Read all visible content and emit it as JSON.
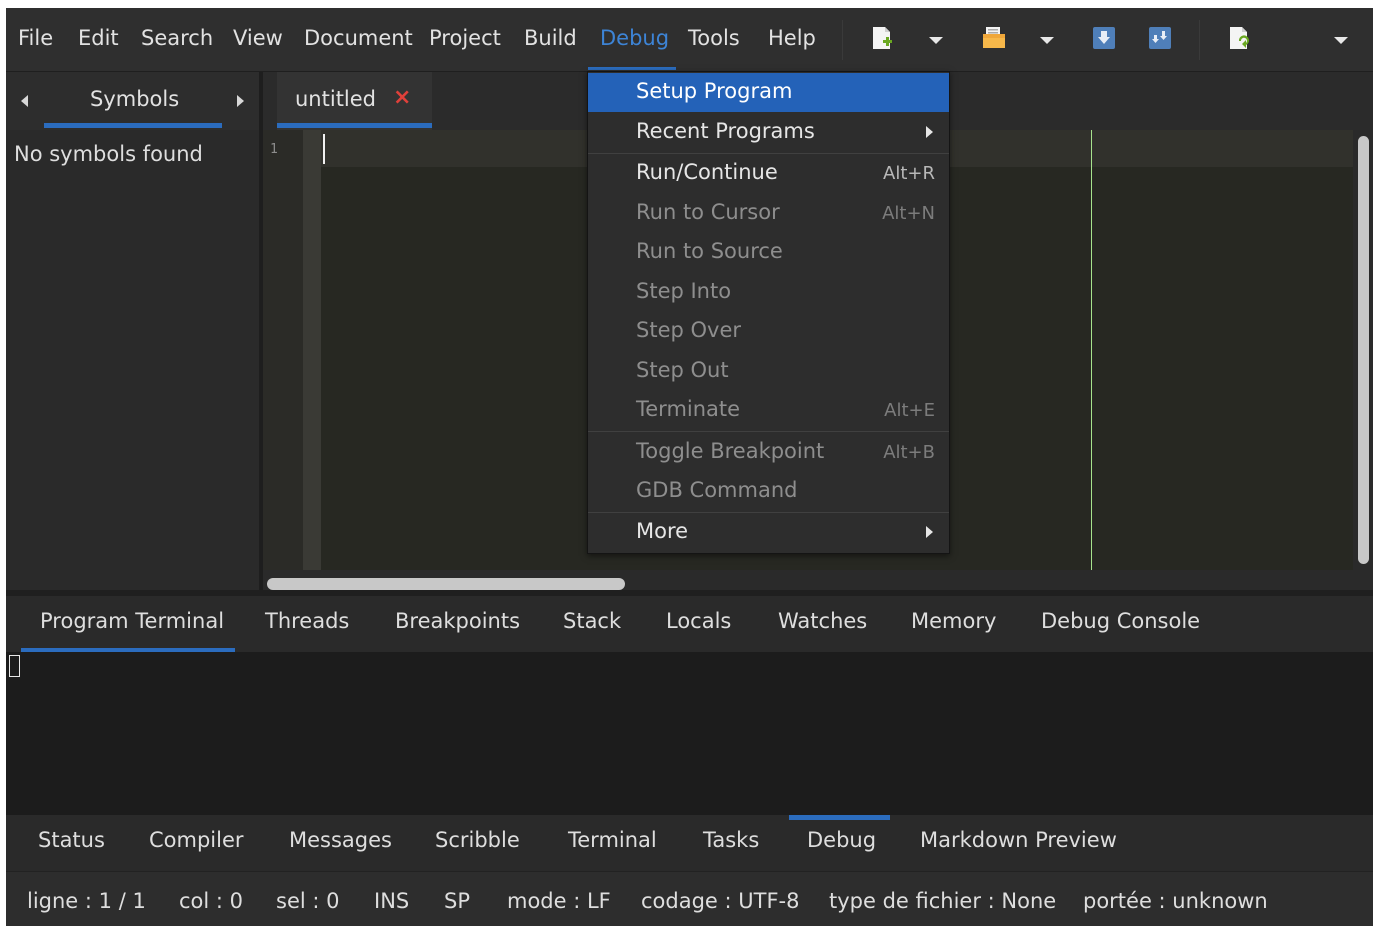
{
  "menubar": {
    "items": [
      "File",
      "Edit",
      "Search",
      "View",
      "Document",
      "Project",
      "Build",
      "Debug",
      "Tools",
      "Help"
    ],
    "active": "Debug"
  },
  "toolbar": {
    "icons": [
      "new-file-icon",
      "dropdown-arrow-icon",
      "open-file-icon",
      "dropdown-arrow-icon",
      "save-icon",
      "save-all-icon",
      "revert-icon",
      "overflow-arrow-icon"
    ]
  },
  "sidebar": {
    "tab_label": "Symbols",
    "empty_text": "No symbols found"
  },
  "editor": {
    "tab_label": "untitled",
    "tab_close": "×",
    "line_number": "1"
  },
  "debug_menu": {
    "items": [
      {
        "label": "Setup Program",
        "shortcut": "",
        "enabled": true,
        "highlighted": true,
        "submenu": false
      },
      {
        "label": "Recent Programs",
        "shortcut": "",
        "enabled": true,
        "highlighted": false,
        "submenu": true
      },
      {
        "label": "Run/Continue",
        "shortcut": "Alt+R",
        "enabled": true,
        "highlighted": false,
        "submenu": false
      },
      {
        "label": "Run to Cursor",
        "shortcut": "Alt+N",
        "enabled": false,
        "highlighted": false,
        "submenu": false
      },
      {
        "label": "Run to Source",
        "shortcut": "",
        "enabled": false,
        "highlighted": false,
        "submenu": false
      },
      {
        "label": "Step Into",
        "shortcut": "",
        "enabled": false,
        "highlighted": false,
        "submenu": false
      },
      {
        "label": "Step Over",
        "shortcut": "",
        "enabled": false,
        "highlighted": false,
        "submenu": false
      },
      {
        "label": "Step Out",
        "shortcut": "",
        "enabled": false,
        "highlighted": false,
        "submenu": false
      },
      {
        "label": "Terminate",
        "shortcut": "Alt+E",
        "enabled": false,
        "highlighted": false,
        "submenu": false
      },
      {
        "label": "Toggle Breakpoint",
        "shortcut": "Alt+B",
        "enabled": false,
        "highlighted": false,
        "submenu": false
      },
      {
        "label": "GDB Command",
        "shortcut": "",
        "enabled": false,
        "highlighted": false,
        "submenu": false
      },
      {
        "label": "More",
        "shortcut": "",
        "enabled": true,
        "highlighted": false,
        "submenu": true
      }
    ]
  },
  "debug_panel": {
    "tabs": [
      "Program Terminal",
      "Threads",
      "Breakpoints",
      "Stack",
      "Locals",
      "Watches",
      "Memory",
      "Debug Console"
    ],
    "active": "Program Terminal"
  },
  "message_window": {
    "tabs": [
      "Status",
      "Compiler",
      "Messages",
      "Scribble",
      "Terminal",
      "Tasks",
      "Debug",
      "Markdown Preview"
    ],
    "active": "Debug"
  },
  "statusbar": {
    "line": "ligne : 1 / 1",
    "col": "col : 0",
    "sel": "sel : 0",
    "ins": "INS",
    "sp": "SP",
    "mode": "mode : LF",
    "encoding": "codage : UTF-8",
    "filetype": "type de fichier : None",
    "scope": "portée : unknown"
  },
  "colors": {
    "accent": "#2b6cbe",
    "active_menu": "#3d84d6",
    "close": "#e0403a",
    "long_line_marker": "#a7e38d"
  }
}
